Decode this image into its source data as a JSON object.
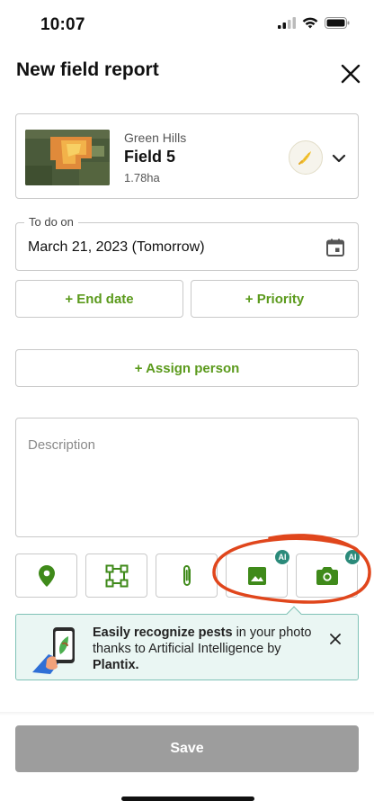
{
  "status_bar": {
    "time": "10:07"
  },
  "header": {
    "title": "New field report",
    "close_icon": "close-icon"
  },
  "field": {
    "farm": "Green Hills",
    "name": "Field 5",
    "area": "1.78ha",
    "crop_icon": "corn-icon",
    "chevron_icon": "chevron-down-icon"
  },
  "todo": {
    "label": "To do on",
    "value": "March 21, 2023 (Tomorrow)",
    "icon": "calendar-icon"
  },
  "buttons": {
    "end_date": "+ End date",
    "priority": "+ Priority",
    "assign_person": "+ Assign person"
  },
  "description": {
    "placeholder": "Description"
  },
  "tools": [
    {
      "icon": "location-pin-icon"
    },
    {
      "icon": "polygon-area-icon"
    },
    {
      "icon": "paperclip-icon"
    },
    {
      "icon": "image-icon",
      "badge": "AI"
    },
    {
      "icon": "camera-icon",
      "badge": "AI"
    }
  ],
  "banner": {
    "strong": "Easily recognize pests",
    "text_mid": " in your photo thanks to Artificial Intelligence by ",
    "brand": "Plantix.",
    "close_icon": "close-icon"
  },
  "footer": {
    "save_label": "Save"
  },
  "colors": {
    "accent_green": "#5b9a1c",
    "ai_teal": "#2b8a7a",
    "banner_bg": "#eaf6f3",
    "annotation_red": "#e0461c",
    "save_disabled": "#9d9d9d"
  }
}
